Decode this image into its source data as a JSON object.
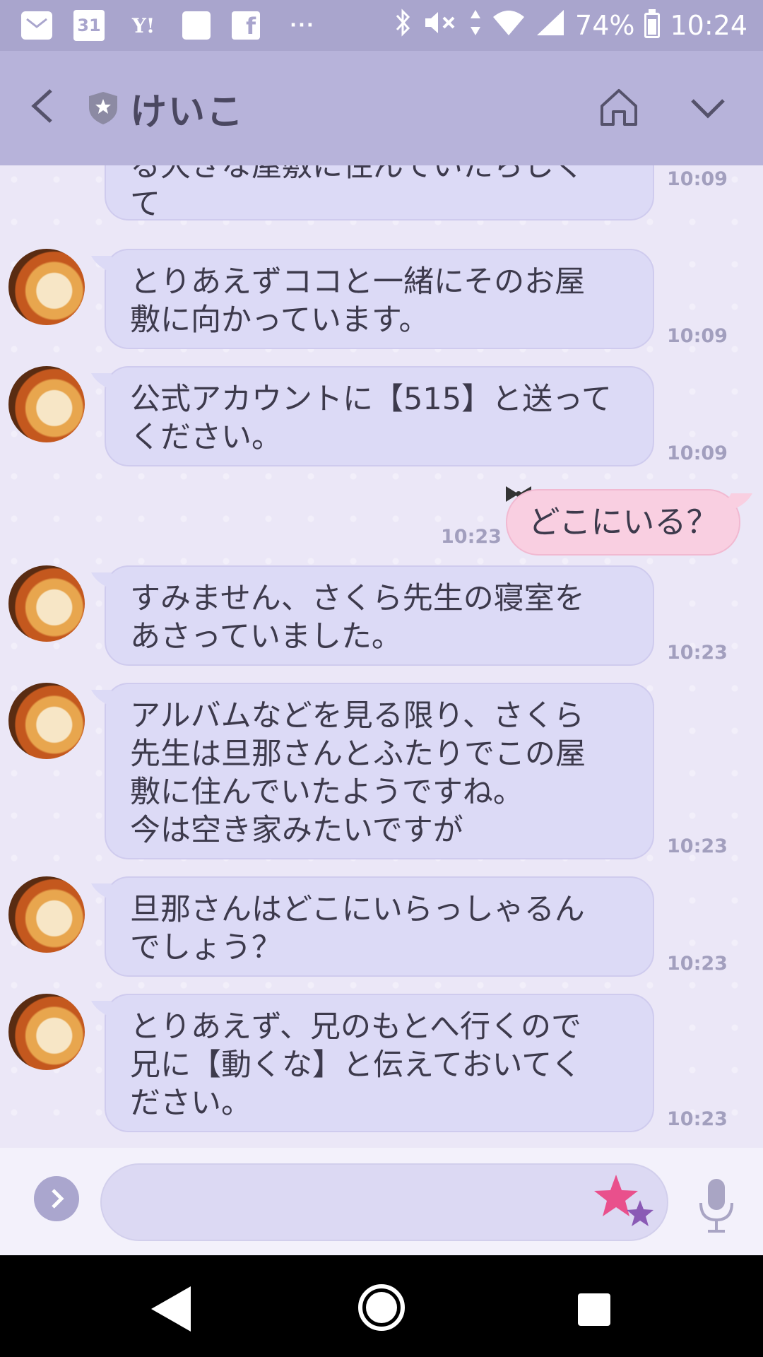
{
  "status_bar": {
    "notification_icons": [
      "mail-icon",
      "calendar-icon",
      "yahoo-icon",
      "square-icon",
      "facebook-icon",
      "more-icon"
    ],
    "calendar_day": "31",
    "yahoo_text": "Y!",
    "more_dots": "···",
    "battery_percent": "74%",
    "time": "10:24",
    "battery_level": 0.74
  },
  "header": {
    "title": "けいこ"
  },
  "messages": [
    {
      "side": "left",
      "text": "る大きな屋敷に住んでいたらしく\nて",
      "time": "10:09"
    },
    {
      "side": "left",
      "text": "とりあえずココと一緒にそのお屋\n敷に向かっています。",
      "time": "10:09"
    },
    {
      "side": "left",
      "text": "公式アカウントに【515】と送って\nください。",
      "time": "10:09"
    },
    {
      "side": "right",
      "text": "どこにいる？",
      "time": "10:23"
    },
    {
      "side": "left",
      "text": "すみません、さくら先生の寝室を\nあさっていました。",
      "time": "10:23"
    },
    {
      "side": "left",
      "text": "アルバムなどを見る限り、さくら\n先生は旦那さんとふたりでこの屋\n敷に住んでいたようですね。\n今は空き家みたいですが",
      "time": "10:23"
    },
    {
      "side": "left",
      "text": "旦那さんはどこにいらっしゃるん\nでしょう？",
      "time": "10:23"
    },
    {
      "side": "left",
      "text": "とりあえず、兄のもとへ行くので\n兄に【動くな】と伝えておいてく\nださい。",
      "time": "10:23"
    }
  ],
  "input": {
    "value": "",
    "placeholder": ""
  },
  "colors": {
    "header_bg": "#b7b3da",
    "status_bg": "#a9a5cd",
    "bubble_left": "#dcdaf6",
    "bubble_right": "#f9cfe1"
  }
}
